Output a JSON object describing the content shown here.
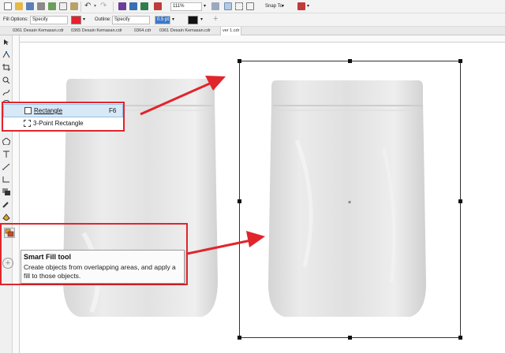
{
  "toolbar": {
    "zoom_value": "111%",
    "snap_label": "Snap To"
  },
  "property_bar": {
    "fill_options_label": "Fill Options:",
    "fill_options_value": "Specify",
    "fill_color": "#e8202a",
    "outline_label": "Outline:",
    "outline_value": "Specify",
    "outline_width": "0.5 pt",
    "outline_color": "#111111"
  },
  "doc_tabs": [
    {
      "label": "0361 Desain Kemasan.cdr"
    },
    {
      "label": "0365 Desain Kemasan.cdr"
    },
    {
      "label": "0364.cdr"
    },
    {
      "label": "0361 Desain Kemasan.cdr"
    },
    {
      "label": "ver 1.cdr"
    }
  ],
  "flyout": {
    "items": [
      {
        "label": "Rectangle",
        "shortcut": "F6",
        "icon": "rectangle-icon",
        "selected": true
      },
      {
        "label": "3-Point Rectangle",
        "shortcut": "",
        "icon": "three-point-rectangle-icon",
        "selected": false
      }
    ]
  },
  "tooltip": {
    "title": "Smart Fill tool",
    "description": "Create objects from overlapping areas, and apply a fill to those objects."
  },
  "colors": {
    "annotation_red": "#e0252b",
    "selection_highlight": "#d7e8f7",
    "pouch_gray": "#e4e4e4"
  }
}
